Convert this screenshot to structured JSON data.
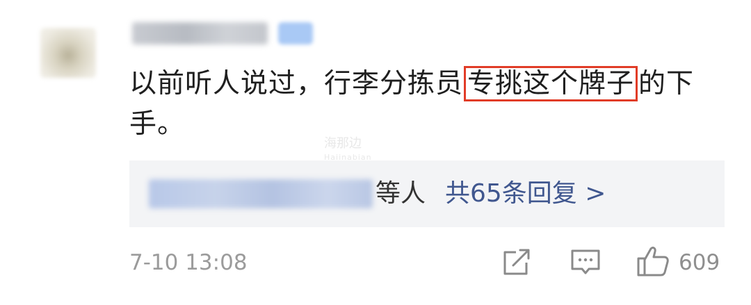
{
  "comment": {
    "text_before": "以前听人说过，行李分拣员",
    "highlighted_text": "专挑这个牌子",
    "text_after": "的下手。",
    "highlight_color": "#e13c27"
  },
  "watermark": {
    "text": "海那边",
    "sub": "Haiinabian"
  },
  "replies": {
    "suffix": "等人",
    "link_text": "共65条回复 >",
    "link_color": "#40578f"
  },
  "footer": {
    "timestamp": "7-10 13:08",
    "like_count": "609",
    "share_icon": "share-icon",
    "comment_icon": "comment-icon",
    "like_icon": "thumbs-up-icon"
  }
}
